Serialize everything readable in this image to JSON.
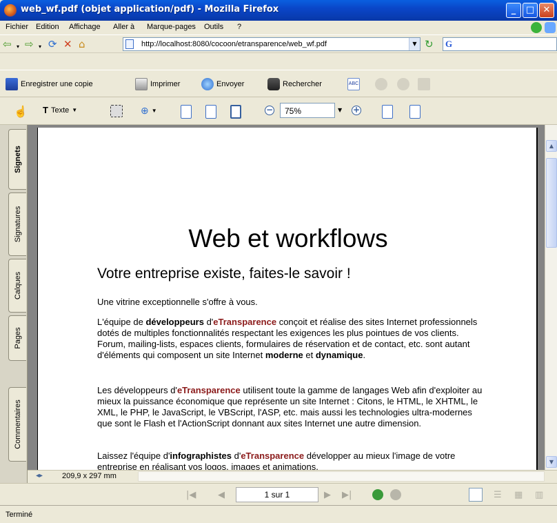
{
  "window": {
    "title": "web_wf.pdf (objet application/pdf) - Mozilla Firefox"
  },
  "menu": [
    "Fichier",
    "Edition",
    "Affichage",
    "Aller à",
    "Marque-pages",
    "Outils",
    "?"
  ],
  "nav": {
    "url": "http://localhost:8080/cocoon/etransparence/web_wf.pdf"
  },
  "toolbar1": {
    "save": "Enregistrer une copie",
    "print": "Imprimer",
    "send": "Envoyer",
    "search": "Rechercher"
  },
  "toolbar2": {
    "text_tool": "Texte",
    "zoom": "75%"
  },
  "tabs": [
    "Signets",
    "Signatures",
    "Calques",
    "Pages",
    "Commentaires"
  ],
  "document": {
    "title": "Web et workflows",
    "subtitle": "Votre entreprise existe, faites-le savoir !",
    "p1": "Une vitrine exceptionnelle s'offre à vous.",
    "p2_a": "L'équipe de ",
    "p2_b": "développeurs",
    "p2_c": " d'",
    "brand": "eTransparence",
    "p2_d": " conçoit et réalise des sites Internet professionnels dotés de multiples fonctionnalités respectant les exigences les plus pointues de vos clients. Forum, mailing-lists, espaces clients, formulaires de réservation et de contact, etc. sont autant d'éléments qui composent un site Internet ",
    "p2_e": "moderne",
    "p2_f": " et ",
    "p2_g": "dynamique",
    "p2_h": ".",
    "p3_a": "Les développeurs d'",
    "p3_b": " utilisent toute la gamme de langages Web afin d'exploiter au mieux la puissance économique que représente un site Internet : Citons, le HTML, le XHTML, le XML, le PHP, le JavaScript, le VBScript, l'ASP, etc. mais aussi les technologies ultra-modernes que sont le Flash et l'ActionScript donnant aux sites Internet une autre dimension.",
    "p4_a": "Laissez l'équipe d'",
    "p4_b": "infographistes",
    "p4_c": " d'",
    "p4_d": " développer au mieux l'image de votre entreprise en réalisant vos logos, images et animations."
  },
  "pagesize": "209,9 x 297 mm",
  "pagenav": {
    "page": "1 sur 1"
  },
  "status": "Terminé"
}
